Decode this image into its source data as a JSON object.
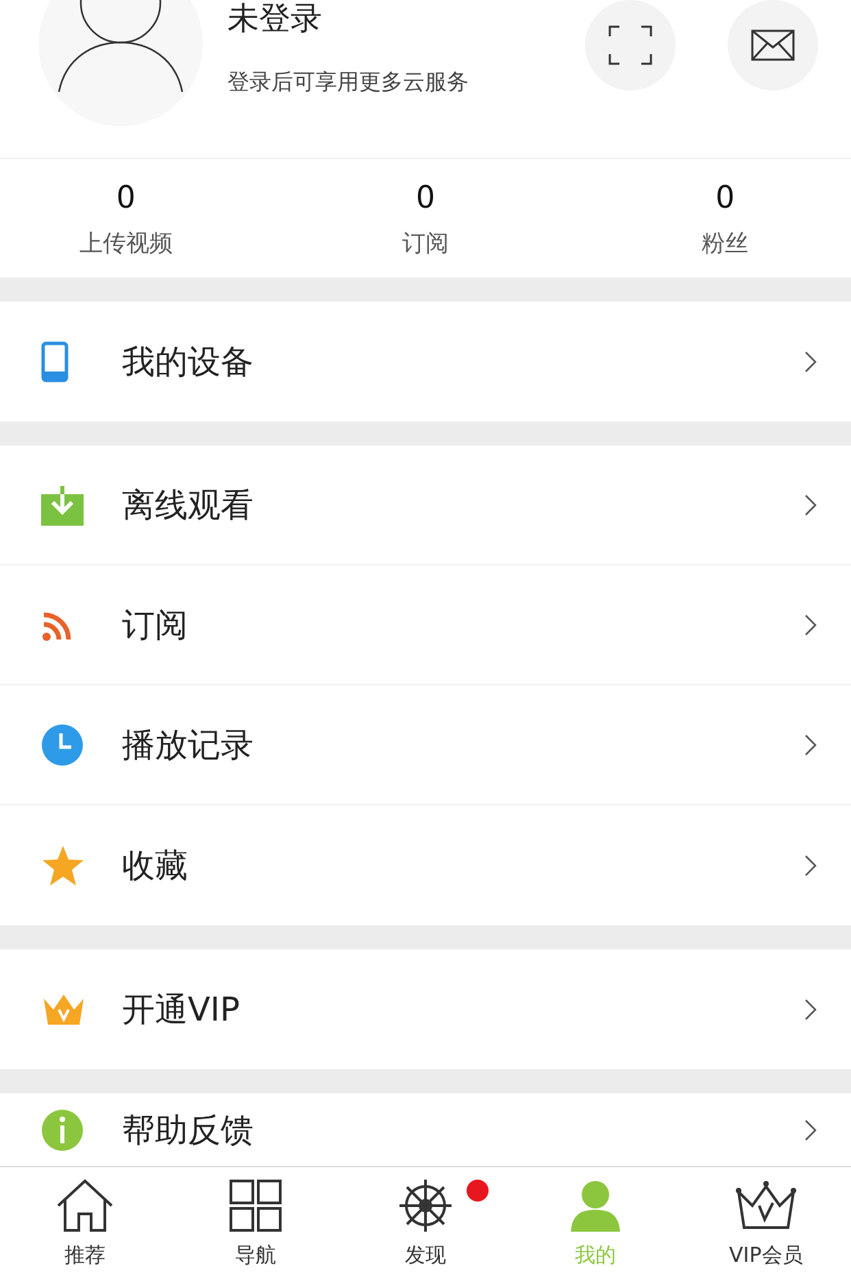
{
  "profile": {
    "name": "未登录",
    "subtitle": "登录后可享用更多云服务"
  },
  "stats": [
    {
      "value": "0",
      "label": "上传视频"
    },
    {
      "value": "0",
      "label": "订阅"
    },
    {
      "value": "0",
      "label": "粉丝"
    }
  ],
  "menu_groups": [
    [
      {
        "kind": "device",
        "label": "我的设备"
      }
    ],
    [
      {
        "kind": "download",
        "label": "离线观看"
      },
      {
        "kind": "rss",
        "label": "订阅"
      },
      {
        "kind": "clock",
        "label": "播放记录"
      },
      {
        "kind": "star",
        "label": "收藏"
      }
    ],
    [
      {
        "kind": "crown",
        "label": "开通VIP"
      }
    ],
    [
      {
        "kind": "help",
        "label": "帮助反馈"
      }
    ]
  ],
  "tabs": [
    {
      "kind": "home",
      "label": "推荐",
      "selected": false,
      "dot": false
    },
    {
      "kind": "grid",
      "label": "导航",
      "selected": false,
      "dot": false
    },
    {
      "kind": "wheel",
      "label": "发现",
      "selected": false,
      "dot": true
    },
    {
      "kind": "person",
      "label": "我的",
      "selected": true,
      "dot": false
    },
    {
      "kind": "vip",
      "label": "VIP会员",
      "selected": false,
      "dot": false
    }
  ]
}
